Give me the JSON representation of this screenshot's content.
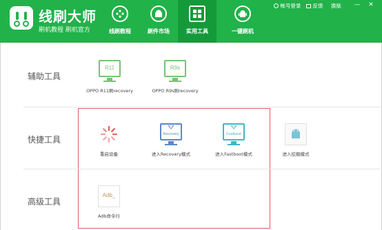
{
  "app": {
    "title": "线刷大师",
    "slogan": "刷机教程  刷机官方"
  },
  "nav": [
    {
      "label": "线刷教程",
      "icon": "compass-icon",
      "active": false
    },
    {
      "label": "刷件市场",
      "icon": "android-market-icon",
      "active": false
    },
    {
      "label": "实用工具",
      "icon": "grid-tools-icon",
      "active": true
    },
    {
      "label": "一键刷机",
      "icon": "android-flash-icon",
      "active": false
    }
  ],
  "toplinks": {
    "login": "帐号登录",
    "feedback": "反馈",
    "skin": "换肤"
  },
  "window": {
    "minimize": "—",
    "close": "✕"
  },
  "sections": [
    {
      "title": "辅助工具",
      "tools": [
        {
          "label": "OPPO R11刷recovery",
          "icon_text": "R11"
        },
        {
          "label": "OPPO R9s刷recovery",
          "icon_text": "R9s"
        }
      ]
    },
    {
      "title": "快捷工具",
      "tools": [
        {
          "label": "重启设备"
        },
        {
          "label": "进入Recovery模式",
          "icon_text": "Recovery"
        },
        {
          "label": "进入Fastboot模式",
          "icon_text": "Fastboot"
        },
        {
          "label": "进入挖掘模式"
        }
      ]
    },
    {
      "title": "高级工具",
      "tools": [
        {
          "label": "Adb命令行",
          "icon_text": "Adb_"
        }
      ]
    }
  ],
  "colors": {
    "header_green": "#21b24a",
    "active_green": "#159a3a",
    "icon_green": "#7ac17a",
    "highlight_red": "#e35a5a",
    "recovery_blue": "#5b87c7",
    "fastboot_cyan": "#3fb7c9",
    "adb_brown": "#c8925a"
  }
}
